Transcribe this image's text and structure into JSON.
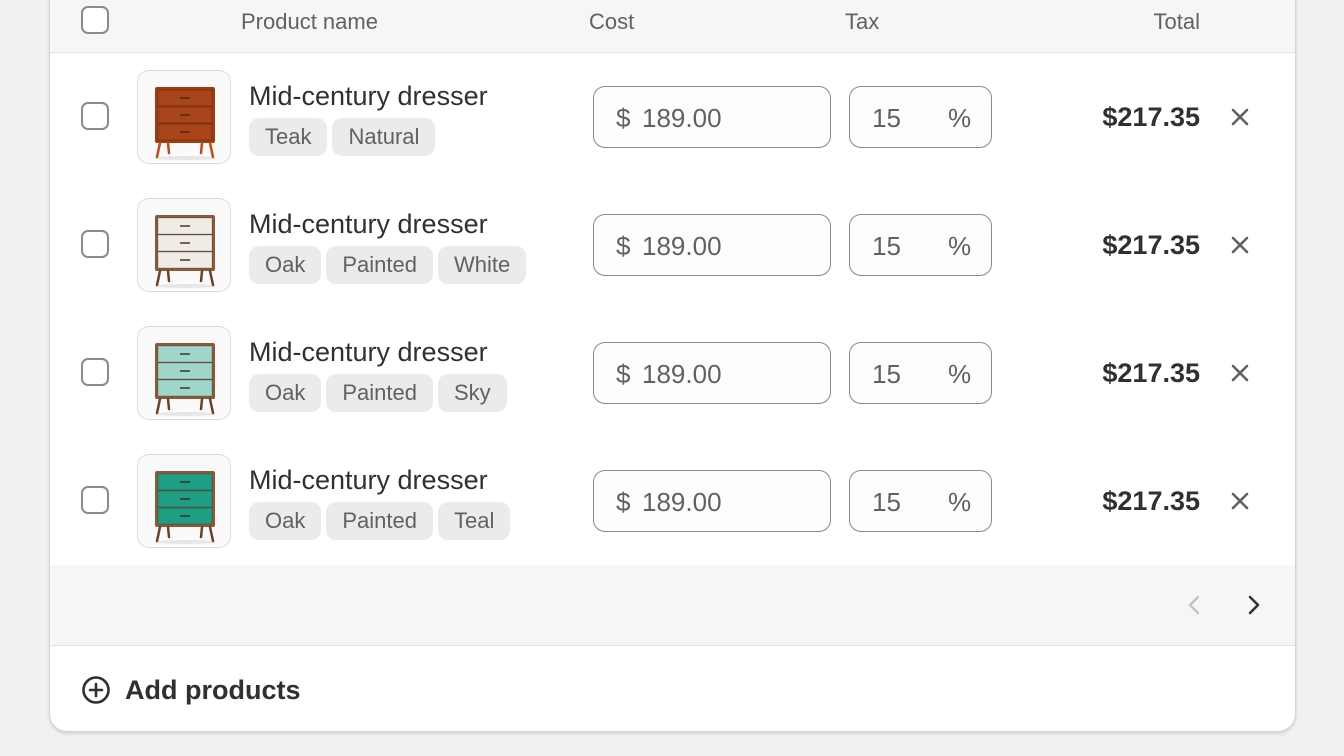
{
  "table": {
    "headers": {
      "product_name": "Product name",
      "cost": "Cost",
      "tax": "Tax",
      "total": "Total"
    },
    "rows": [
      {
        "name": "Mid-century dresser",
        "tags": [
          "Teak",
          "Natural"
        ],
        "cost_prefix": "$",
        "cost": "189.00",
        "tax": "15",
        "tax_suffix": "%",
        "total": "$217.35",
        "thumb_body_color": "#9c3d14",
        "thumb_drawer_color": "#a8431a",
        "thumb_leg_color": "#c24a12"
      },
      {
        "name": "Mid-century dresser",
        "tags": [
          "Oak",
          "Painted",
          "White"
        ],
        "cost_prefix": "$",
        "cost": "189.00",
        "tax": "15",
        "tax_suffix": "%",
        "total": "$217.35",
        "thumb_body_color": "#8a5a3a",
        "thumb_drawer_color": "#efece6",
        "thumb_leg_color": "#6e4027"
      },
      {
        "name": "Mid-century dresser",
        "tags": [
          "Oak",
          "Painted",
          "Sky"
        ],
        "cost_prefix": "$",
        "cost": "189.00",
        "tax": "15",
        "tax_suffix": "%",
        "total": "$217.35",
        "thumb_body_color": "#8a5a3a",
        "thumb_drawer_color": "#9fd6cc",
        "thumb_leg_color": "#6e4027"
      },
      {
        "name": "Mid-century dresser",
        "tags": [
          "Oak",
          "Painted",
          "Teal"
        ],
        "cost_prefix": "$",
        "cost": "189.00",
        "tax": "15",
        "tax_suffix": "%",
        "total": "$217.35",
        "thumb_body_color": "#8a5a3a",
        "thumb_drawer_color": "#1f9e86",
        "thumb_leg_color": "#6e4027"
      }
    ]
  },
  "pagination": {
    "previous_icon": "chevron-left-icon",
    "next_icon": "chevron-right-icon",
    "previous_enabled": false,
    "next_enabled": true
  },
  "footer": {
    "add_label": "Add products",
    "add_icon": "plus-circle-icon"
  },
  "colors": {
    "text": "#303030",
    "muted": "#616161",
    "border": "#e3e3e3",
    "header_bg": "#f6f6f6"
  }
}
